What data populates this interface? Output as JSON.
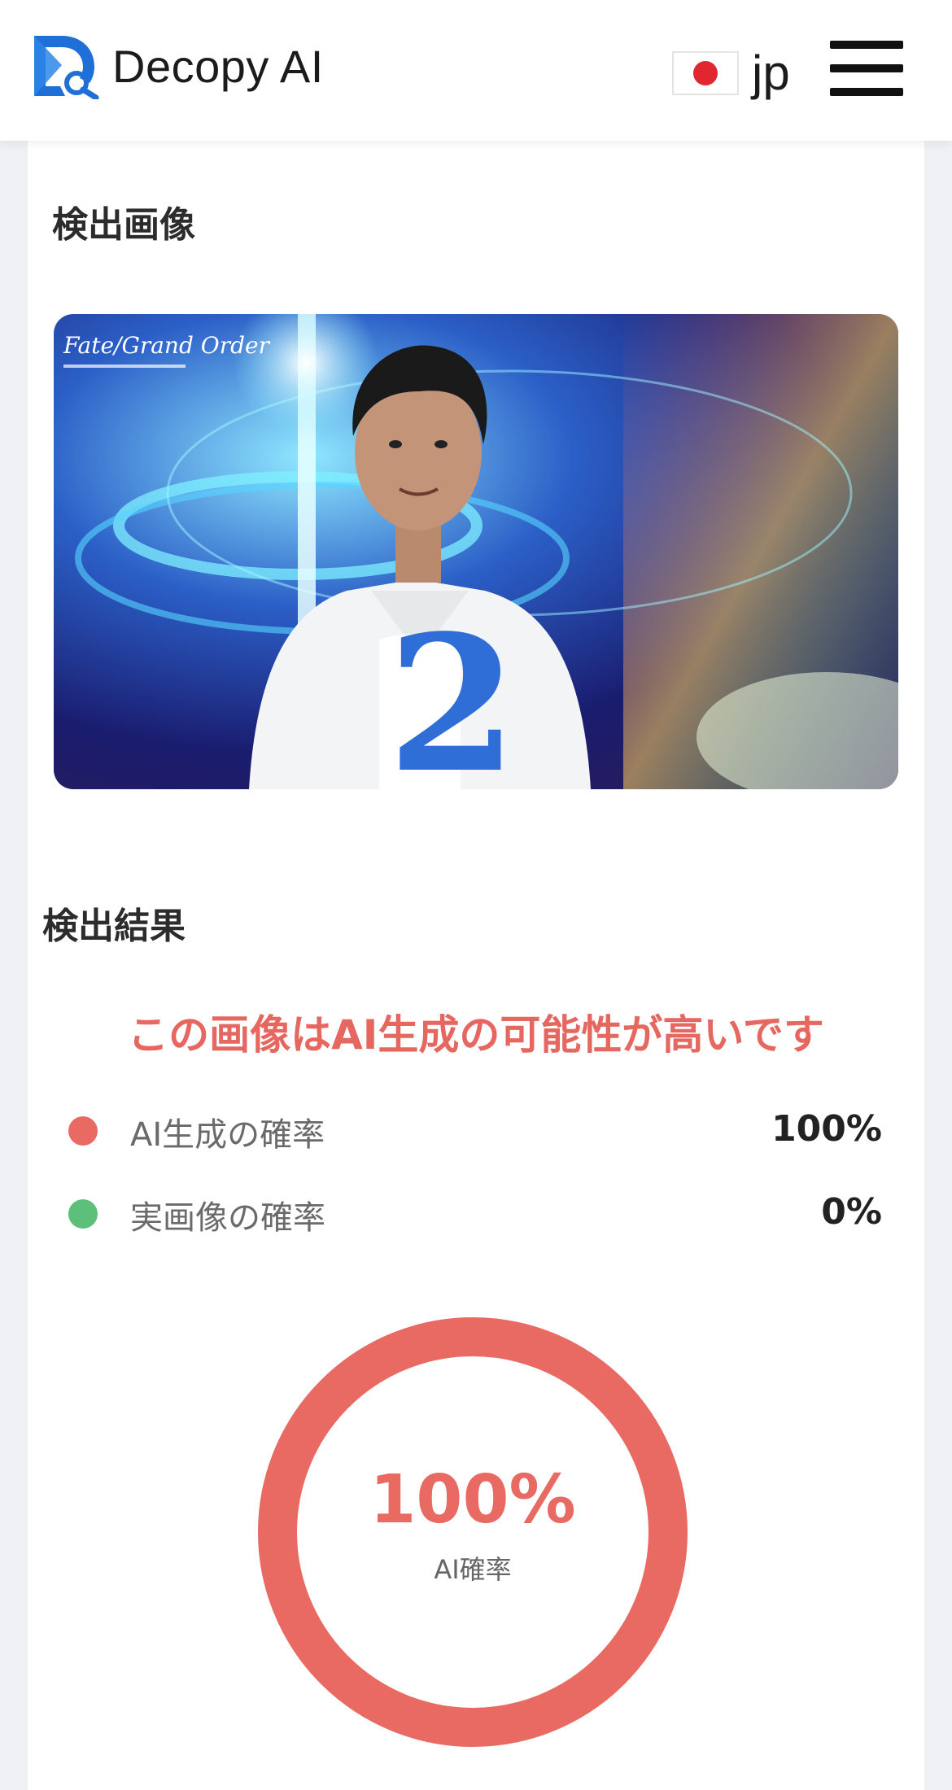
{
  "header": {
    "app_name": "Decopy AI",
    "language_code": "jp",
    "flag_icon": "japan-flag-icon",
    "menu_icon": "hamburger-menu-icon",
    "brand_color": "#1e6fd6"
  },
  "detected_image": {
    "section_title": "検出画像",
    "photo_caption_logo": "Fate/Grand Order"
  },
  "result": {
    "section_title": "検出結果",
    "headline": "この画像はAI生成の可能性が高いです",
    "headline_color": "#e5675f",
    "rows": [
      {
        "label": "AI生成の確率",
        "value": "100%",
        "dot_color": "#e86a63"
      },
      {
        "label": "実画像の確率",
        "value": "0%",
        "dot_color": "#5cc07a"
      }
    ],
    "gauge": {
      "value_text": "100%",
      "caption": "AI確率",
      "fraction": 1.0,
      "color": "#e86a63"
    }
  }
}
